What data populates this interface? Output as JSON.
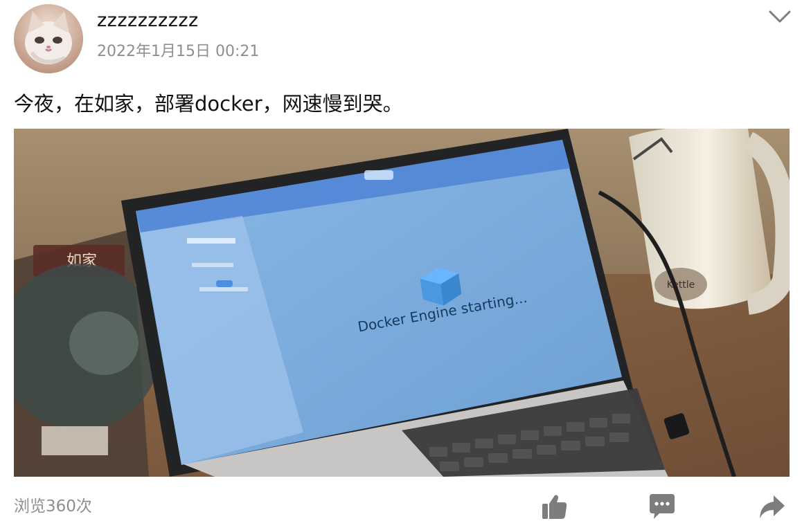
{
  "post": {
    "author": "zzzzzzzzzz",
    "timestamp": "2022年1月15日 00:21",
    "text": "今夜，在如家，部署docker，网速慢到哭。"
  },
  "photo": {
    "screen_status": "Docker Engine starting...",
    "sign_text": "如家"
  },
  "footer": {
    "views": "浏览360次"
  },
  "icons": {
    "avatar": "cat-avatar",
    "more": "chevron-down-icon",
    "like": "thumbs-up-icon",
    "comment": "comment-icon",
    "share": "share-icon"
  },
  "colors": {
    "icon_gray": "#7d7d7d",
    "secondary_text": "#8e8e8e",
    "screen_blue": "#7fb0e1"
  }
}
